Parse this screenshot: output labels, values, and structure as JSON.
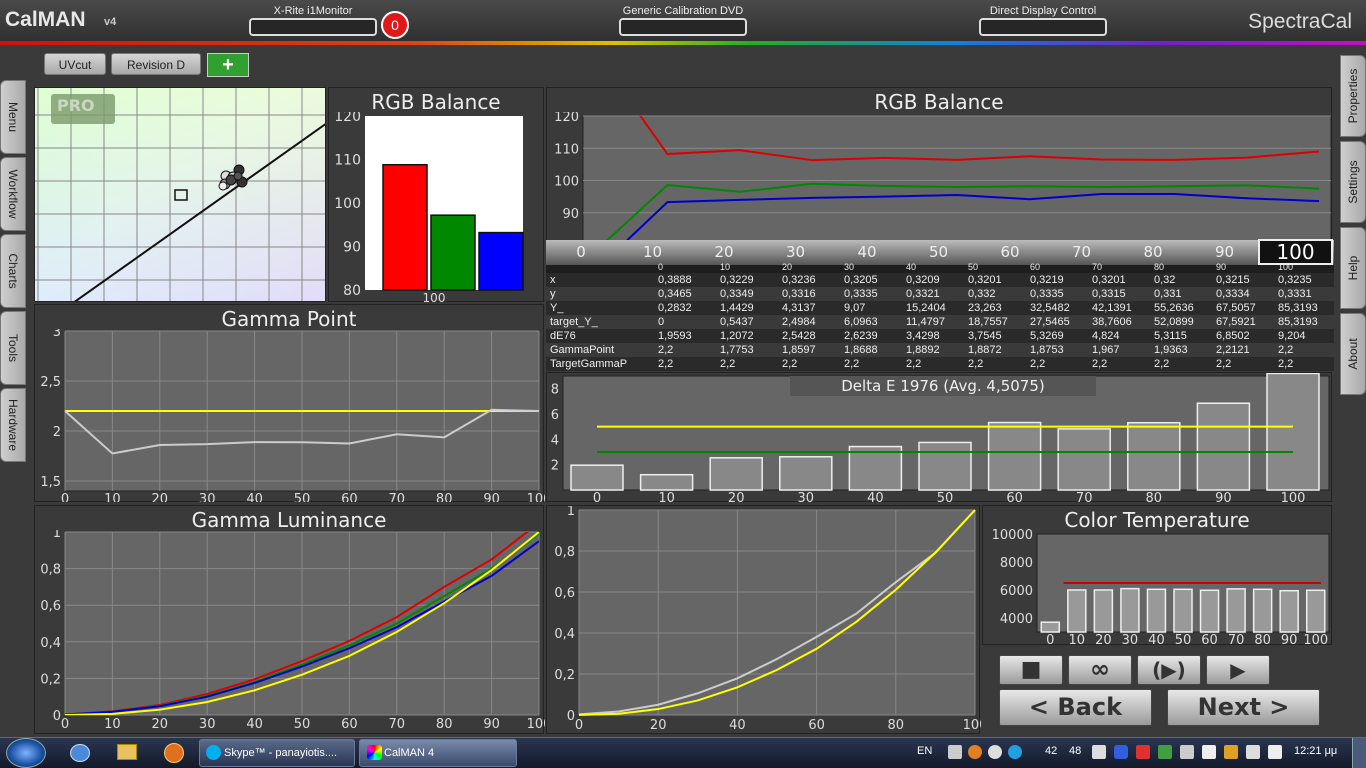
{
  "app": {
    "logo": "CalMAN",
    "logo_version": "v4",
    "brand": "SpectraCal"
  },
  "devices": [
    {
      "label": "X-Rite i1Monitor",
      "value": ""
    },
    {
      "label": "Generic Calibration DVD",
      "value": ""
    },
    {
      "label": "Direct Display Control",
      "value": ""
    }
  ],
  "badge_count": "0",
  "tabs": [
    {
      "label": "UVcut"
    },
    {
      "label": "Revision D"
    }
  ],
  "add_symbol": "+",
  "left_tabs": [
    "Menu",
    "Workflow",
    "Charts",
    "Tools",
    "Hardware"
  ],
  "right_tabs": [
    "Properties",
    "Settings",
    "Help",
    "About"
  ],
  "cie": {
    "pro_badge": "PRO"
  },
  "rgb_bar": {
    "title": "RGB Balance",
    "xlabel": "100",
    "yticks": [
      "120",
      "110",
      "100",
      "90",
      "80"
    ],
    "ylim": [
      80,
      120
    ],
    "values": [
      {
        "color": "#ff0000",
        "v": 108.8
      },
      {
        "color": "#008800",
        "v": 97.2
      },
      {
        "color": "#0000ff",
        "v": 93.2
      }
    ]
  },
  "rgb_line": {
    "title": "RGB Balance",
    "yticks": [
      "120",
      "110",
      "100",
      "90",
      "80"
    ],
    "ylim": [
      80,
      120
    ],
    "x": [
      0,
      10,
      20,
      30,
      40,
      50,
      60,
      70,
      80,
      90,
      100
    ],
    "series": [
      {
        "color": "#dd0000",
        "values": [
          140,
          108.2,
          109.4,
          106.3,
          107.0,
          106.4,
          107.5,
          106.5,
          106.4,
          107.1,
          109.0
        ]
      },
      {
        "color": "#008800",
        "values": [
          78,
          98.6,
          96.5,
          99.0,
          98.3,
          98.0,
          98.2,
          98.0,
          98.2,
          98.5,
          97.5
        ]
      },
      {
        "color": "#0000cc",
        "values": [
          72,
          93.3,
          94.0,
          94.6,
          95.0,
          95.5,
          94.2,
          95.8,
          95.8,
          94.5,
          93.6
        ]
      }
    ],
    "slider_labels": [
      "0",
      "10",
      "20",
      "30",
      "40",
      "50",
      "60",
      "70",
      "80",
      "90"
    ],
    "selected": "100"
  },
  "table": {
    "headers": [
      "0",
      "10",
      "20",
      "30",
      "40",
      "50",
      "60",
      "70",
      "80",
      "90",
      "100"
    ],
    "rows": [
      {
        "name": "x",
        "values": [
          "0,3888",
          "0,3229",
          "0,3236",
          "0,3205",
          "0,3209",
          "0,3201",
          "0,3219",
          "0,3201",
          "0,32",
          "0,3215",
          "0,3235"
        ]
      },
      {
        "name": "y",
        "values": [
          "0,3465",
          "0,3349",
          "0,3316",
          "0,3335",
          "0,3321",
          "0,332",
          "0,3335",
          "0,3315",
          "0,331",
          "0,3334",
          "0,3331"
        ]
      },
      {
        "name": "Y_",
        "values": [
          "0,2832",
          "1,4429",
          "4,3137",
          "9,07",
          "15,2404",
          "23,263",
          "32,5482",
          "42,1391",
          "55,2636",
          "67,5057",
          "85,3193"
        ]
      },
      {
        "name": "target_Y_",
        "values": [
          "0",
          "0,5437",
          "2,4984",
          "6,0963",
          "11,4797",
          "18,7557",
          "27,5465",
          "38,7606",
          "52,0899",
          "67,5921",
          "85,3193"
        ]
      },
      {
        "name": "dE76",
        "values": [
          "1,9593",
          "1,2072",
          "2,5428",
          "2,6239",
          "3,4298",
          "3,7545",
          "5,3269",
          "4,824",
          "5,3115",
          "6,8502",
          "9,204"
        ]
      },
      {
        "name": "GammaPoint",
        "values": [
          "2,2",
          "1,7753",
          "1,8597",
          "1,8688",
          "1,8892",
          "1,8872",
          "1,8753",
          "1,967",
          "1,9363",
          "2,2121",
          "2,2"
        ]
      },
      {
        "name": "TargetGammaP",
        "values": [
          "2,2",
          "2,2",
          "2,2",
          "2,2",
          "2,2",
          "2,2",
          "2,2",
          "2,2",
          "2,2",
          "2,2",
          "2,2"
        ]
      }
    ]
  },
  "deltae": {
    "title": "Delta E 1976 (Avg. 4,5075)",
    "yticks": [
      "8",
      "6",
      "4",
      "2"
    ],
    "ylim": [
      0,
      9
    ],
    "categories": [
      "0",
      "10",
      "20",
      "30",
      "40",
      "50",
      "60",
      "70",
      "80",
      "90",
      "100"
    ],
    "values": [
      1.9593,
      1.2072,
      2.5428,
      2.6239,
      3.4298,
      3.7545,
      5.3269,
      4.824,
      5.3115,
      6.8502,
      9.204
    ],
    "yellow_line": 5,
    "green_line": 3
  },
  "gamma_point": {
    "title": "Gamma Point",
    "yticks": [
      "3",
      "2,5",
      "2",
      "1,5"
    ],
    "ylim": [
      1.4,
      3
    ],
    "xticks": [
      "0",
      "10",
      "20",
      "30",
      "40",
      "50",
      "60",
      "70",
      "80",
      "90",
      "100"
    ],
    "values": [
      2.2,
      1.7753,
      1.8597,
      1.8688,
      1.8892,
      1.8872,
      1.8753,
      1.967,
      1.9363,
      2.2121,
      2.2
    ],
    "target": 2.2
  },
  "gamma_lum": {
    "title": "Gamma Luminance",
    "yticks": [
      "1",
      "0,8",
      "0,6",
      "0,4",
      "0,2",
      "0"
    ],
    "xticks": [
      "0",
      "10",
      "20",
      "30",
      "40",
      "50",
      "60",
      "70",
      "80",
      "90",
      "100"
    ],
    "series": [
      {
        "color": "#dd0000",
        "values": [
          0.003,
          0.02,
          0.055,
          0.115,
          0.195,
          0.295,
          0.405,
          0.535,
          0.7,
          0.85,
          1.05
        ]
      },
      {
        "color": "#008800",
        "values": [
          0.003,
          0.018,
          0.05,
          0.105,
          0.18,
          0.275,
          0.38,
          0.5,
          0.65,
          0.8,
          0.99
        ]
      },
      {
        "color": "#0000cc",
        "values": [
          0.003,
          0.017,
          0.048,
          0.1,
          0.175,
          0.265,
          0.365,
          0.48,
          0.62,
          0.76,
          0.95
        ]
      },
      {
        "color": "#ffff00",
        "values": [
          0,
          0.006,
          0.029,
          0.071,
          0.135,
          0.22,
          0.323,
          0.454,
          0.611,
          0.792,
          1.0
        ]
      }
    ]
  },
  "lum_curve": {
    "yticks": [
      "1",
      "0,8",
      "0,6",
      "0,4",
      "0,2",
      "0"
    ],
    "xticks": [
      "0",
      "20",
      "40",
      "60",
      "80",
      "100"
    ],
    "series": [
      {
        "color": "#cccccc",
        "values": [
          0.003,
          0.017,
          0.05,
          0.106,
          0.179,
          0.273,
          0.381,
          0.494,
          0.648,
          0.791,
          1.0
        ]
      },
      {
        "color": "#ffff00",
        "values": [
          0,
          0.006,
          0.029,
          0.071,
          0.135,
          0.22,
          0.323,
          0.454,
          0.611,
          0.792,
          1.0
        ]
      }
    ]
  },
  "color_temp": {
    "title": "Color Temperature",
    "yticks": [
      "10000",
      "8000",
      "6000",
      "4000"
    ],
    "ylim": [
      3000,
      10000
    ],
    "categories": [
      "0",
      "10",
      "20",
      "30",
      "40",
      "50",
      "60",
      "70",
      "80",
      "90",
      "100"
    ],
    "values": [
      3700,
      6000,
      6000,
      6100,
      6050,
      6050,
      5980,
      6080,
      6050,
      5950,
      5980
    ],
    "target": 6500
  },
  "controls": {
    "stop_icon": "■",
    "loop_icon": "∞",
    "play_once_icon": "(▶)",
    "play_icon": "▶",
    "back_label": "< Back",
    "next_label": "Next >"
  },
  "taskbar": {
    "tasks": [
      {
        "label": "Skype™ - panayiotis...."
      },
      {
        "label": "CalMAN 4"
      }
    ],
    "lang": "EN",
    "tray_nums": [
      "42",
      "48"
    ],
    "clock": "12:21 μμ"
  }
}
